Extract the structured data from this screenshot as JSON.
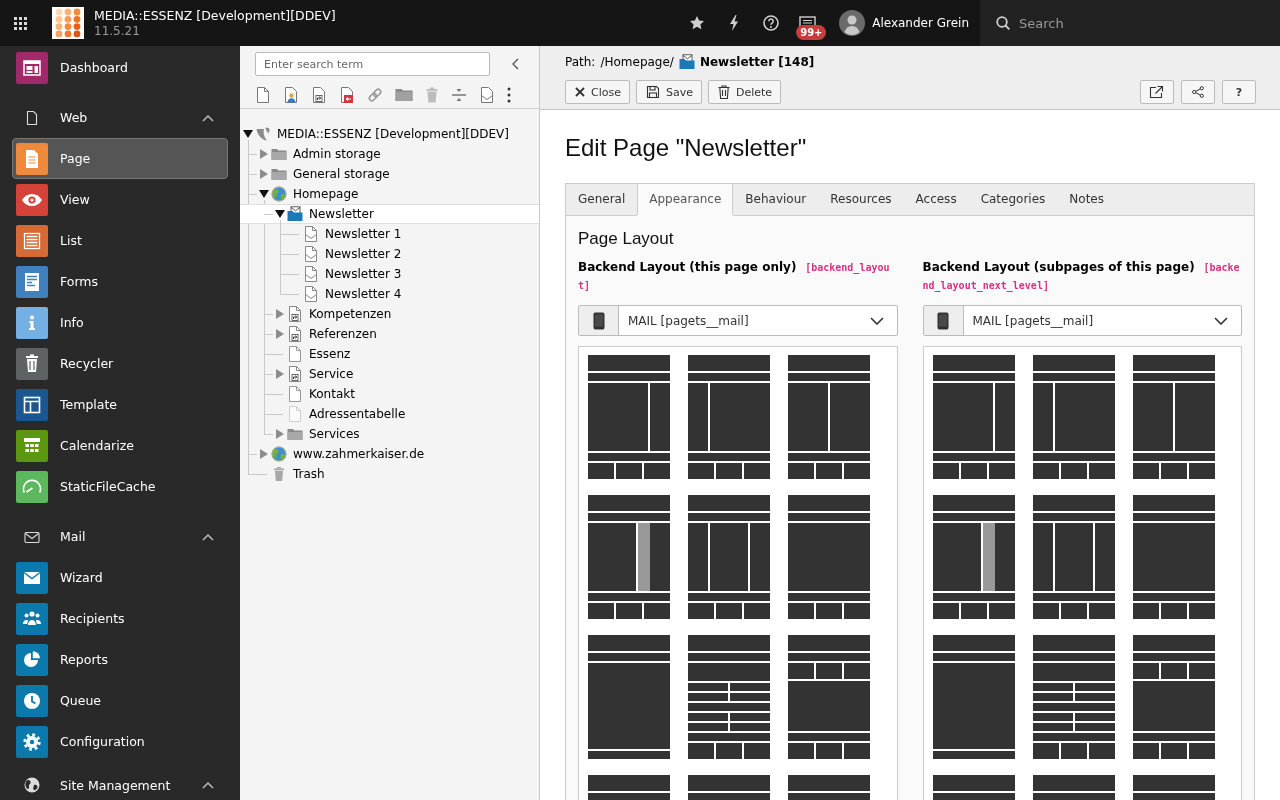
{
  "topbar": {
    "title": "MEDIA::ESSENZ [Development][DDEV]",
    "version": "11.5.21",
    "notifications": "99+",
    "user": "Alexander Grein",
    "search": {
      "placeholder": "Search"
    }
  },
  "module_menu": [
    {
      "kind": "module",
      "label": "Dashboard",
      "color": "#a1286b",
      "selected": false
    },
    {
      "kind": "group",
      "label": "Web",
      "expanded": true,
      "children": [
        {
          "kind": "module",
          "label": "Page",
          "color": "#ef8a3c",
          "selected": true
        },
        {
          "kind": "module",
          "label": "View",
          "color": "#d4423a",
          "selected": false
        },
        {
          "kind": "module",
          "label": "List",
          "color": "#d46a35",
          "selected": false
        },
        {
          "kind": "module",
          "label": "Forms",
          "color": "#3f80bd",
          "selected": false
        },
        {
          "kind": "module",
          "label": "Info",
          "color": "#74b0e4",
          "selected": false
        },
        {
          "kind": "module",
          "label": "Recycler",
          "color": "#5e6264",
          "selected": false
        },
        {
          "kind": "module",
          "label": "Template",
          "color": "#1c5690",
          "selected": false
        },
        {
          "kind": "module",
          "label": "Calendarize",
          "color": "#5b980f",
          "selected": false
        },
        {
          "kind": "module",
          "label": "StaticFileCache",
          "color": "#5cb85c",
          "selected": false
        }
      ]
    },
    {
      "kind": "group",
      "label": "Mail",
      "expanded": true,
      "children": [
        {
          "kind": "module",
          "label": "Wizard",
          "color": "#0b79ab",
          "selected": false
        },
        {
          "kind": "module",
          "label": "Recipients",
          "color": "#0b79ab",
          "selected": false
        },
        {
          "kind": "module",
          "label": "Reports",
          "color": "#0b79ab",
          "selected": false
        },
        {
          "kind": "module",
          "label": "Queue",
          "color": "#0b79ab",
          "selected": false
        },
        {
          "kind": "module",
          "label": "Configuration",
          "color": "#0b79ab",
          "selected": false
        }
      ]
    },
    {
      "kind": "group",
      "label": "Site Management",
      "expanded": true
    }
  ],
  "page_tree": {
    "search": {
      "placeholder": "Enter search term"
    },
    "nodes": [
      {
        "kind": "root",
        "label": "MEDIA::ESSENZ [Development][DDEV]",
        "expanded": true,
        "selected": false,
        "children": [
          {
            "kind": "folder",
            "label": "Admin storage",
            "expanded": false,
            "selected": false
          },
          {
            "kind": "folder",
            "label": "General storage",
            "expanded": false,
            "selected": false
          },
          {
            "kind": "website",
            "label": "Homepage",
            "expanded": true,
            "selected": false,
            "children": [
              {
                "kind": "mailfolder",
                "label": "Newsletter",
                "expanded": true,
                "selected": true,
                "children": [
                  {
                    "kind": "mail",
                    "label": "Newsletter 1",
                    "selected": false
                  },
                  {
                    "kind": "mail",
                    "label": "Newsletter 2",
                    "selected": false
                  },
                  {
                    "kind": "mail",
                    "label": "Newsletter 3",
                    "selected": false
                  },
                  {
                    "kind": "mail",
                    "label": "Newsletter 4",
                    "selected": false
                  }
                ]
              },
              {
                "kind": "shortcut",
                "label": "Kompetenzen",
                "expanded": false,
                "selected": false
              },
              {
                "kind": "shortcut",
                "label": "Referenzen",
                "expanded": false,
                "selected": false
              },
              {
                "kind": "page",
                "label": "Essenz",
                "selected": false
              },
              {
                "kind": "shortcut",
                "label": "Service",
                "expanded": false,
                "selected": false
              },
              {
                "kind": "page",
                "label": "Kontakt",
                "selected": false
              },
              {
                "kind": "hiddenpage",
                "label": "Adressentabelle",
                "selected": false
              },
              {
                "kind": "folder",
                "label": "Services",
                "expanded": false,
                "selected": false
              }
            ]
          },
          {
            "kind": "website",
            "label": "www.zahmerkaiser.de",
            "expanded": false,
            "selected": false
          },
          {
            "kind": "recycler",
            "label": "Trash",
            "selected": false
          }
        ]
      }
    ]
  },
  "doc_header": {
    "path": {
      "prefix": "Path:",
      "trail": "/Homepage/",
      "page": "Newsletter [148]"
    },
    "buttons": [
      {
        "kind": "close",
        "label": "Close"
      },
      {
        "kind": "save",
        "label": "Save"
      },
      {
        "kind": "delete",
        "label": "Delete"
      }
    ],
    "actions": [
      {
        "kind": "view"
      },
      {
        "kind": "share"
      },
      {
        "kind": "help",
        "label": "?"
      }
    ]
  },
  "form": {
    "title": "Edit Page \"Newsletter\"",
    "tabs": [
      {
        "label": "General",
        "selected": false
      },
      {
        "label": "Appearance",
        "selected": true
      },
      {
        "label": "Behaviour",
        "selected": false
      },
      {
        "label": "Resources",
        "selected": false
      },
      {
        "label": "Access",
        "selected": false
      },
      {
        "label": "Categories",
        "selected": false
      },
      {
        "label": "Notes",
        "selected": false
      }
    ],
    "section": "Page Layout",
    "fields": [
      {
        "label": "Backend Layout (this page only)",
        "field_name": "[backend_layout]",
        "value": "MAIL [pagets__mail]",
        "options": [
          {
            "kind": "sidebar-right"
          },
          {
            "kind": "sidebar-left"
          },
          {
            "kind": "two-columns"
          },
          {
            "kind": "three-columns-marked"
          },
          {
            "kind": "three-columns"
          },
          {
            "kind": "single-column"
          },
          {
            "kind": "no-footer"
          },
          {
            "kind": "grid-rows"
          },
          {
            "kind": "teaser-row"
          },
          {
            "kind": "header-only"
          },
          {
            "kind": "header-only"
          },
          {
            "kind": "header-only"
          }
        ]
      },
      {
        "label": "Backend Layout (subpages of this page)",
        "field_name": "[backend_layout_next_level]",
        "value": "MAIL [pagets__mail]",
        "options": [
          {
            "kind": "sidebar-right"
          },
          {
            "kind": "sidebar-left"
          },
          {
            "kind": "two-columns"
          },
          {
            "kind": "three-columns-marked"
          },
          {
            "kind": "three-columns"
          },
          {
            "kind": "single-column"
          },
          {
            "kind": "no-footer"
          },
          {
            "kind": "grid-rows"
          },
          {
            "kind": "teaser-row"
          },
          {
            "kind": "header-only"
          },
          {
            "kind": "header-only"
          },
          {
            "kind": "header-only"
          }
        ]
      }
    ]
  }
}
